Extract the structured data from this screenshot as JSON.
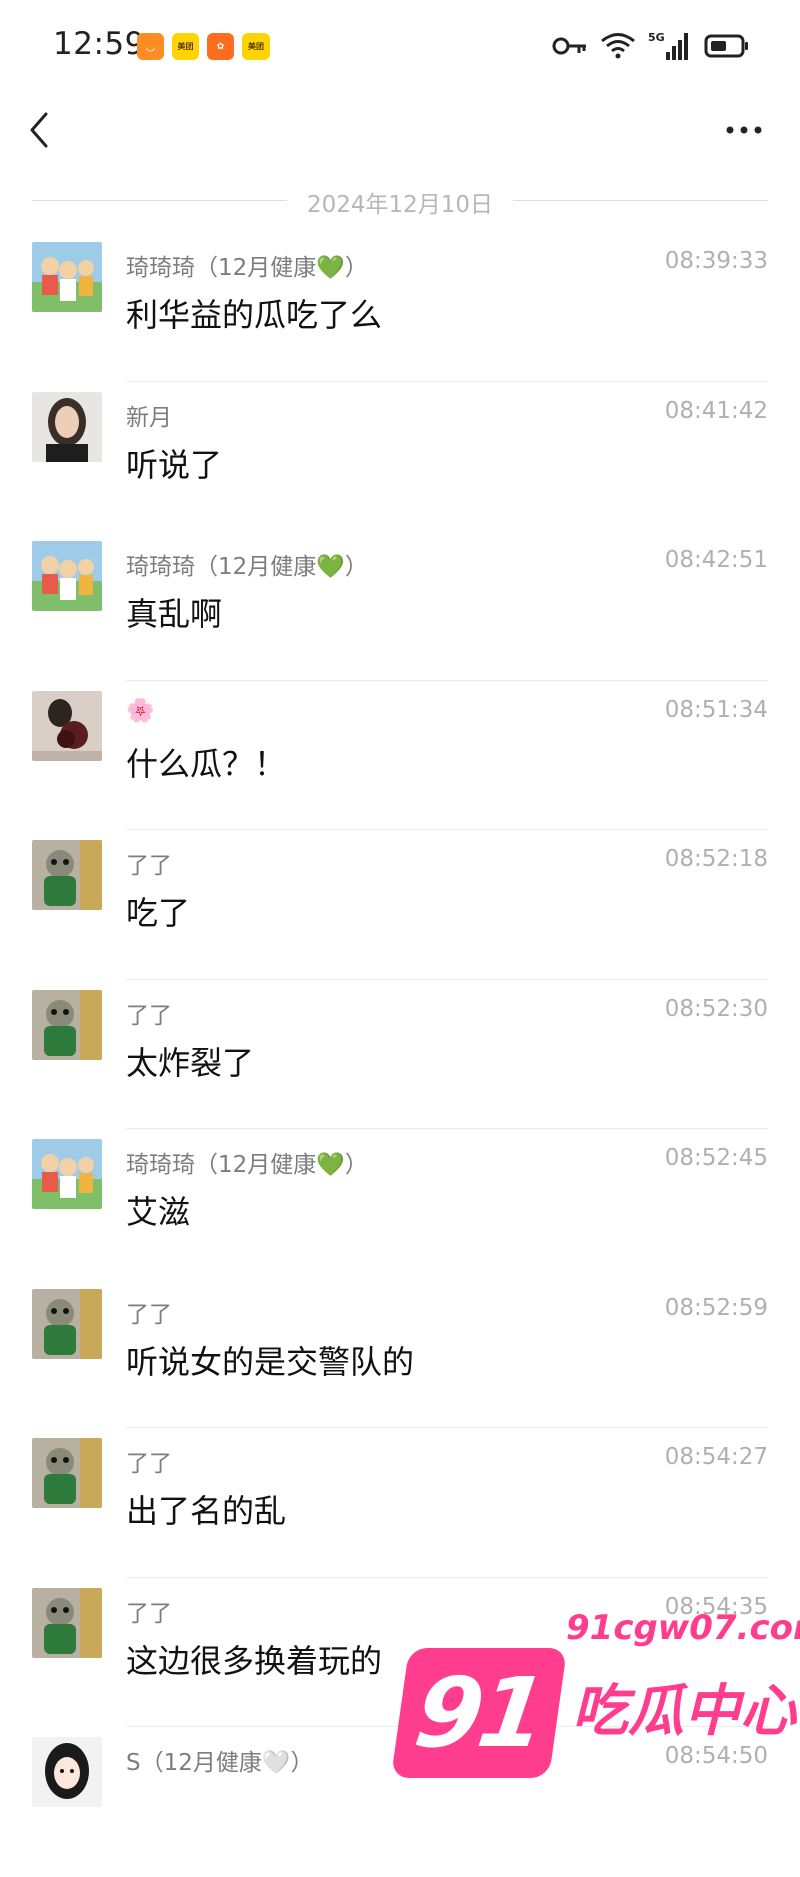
{
  "status_bar": {
    "time": "12:59",
    "badges": [
      "美团",
      "美团",
      "美团",
      "美团"
    ],
    "network": "5G"
  },
  "date_divider": "2024年12月10日",
  "messages": [
    {
      "sender": "琦琦琦（12月健康💚）",
      "time": "08:39:33",
      "text": "利华益的瓜吃了么",
      "avatar": "cartoon-group-avatar"
    },
    {
      "sender": "新月",
      "time": "08:41:42",
      "text": "听说了",
      "avatar": "woman-portrait-avatar"
    },
    {
      "sender": "琦琦琦（12月健康💚）",
      "time": "08:42:51",
      "text": "真乱啊",
      "avatar": "cartoon-group-avatar"
    },
    {
      "sender": "🌸",
      "time": "08:51:34",
      "text": "什么瓜？！",
      "avatar": "flowers-photo-avatar"
    },
    {
      "sender": "了了",
      "time": "08:52:18",
      "text": "吃了",
      "avatar": "plush-toy-avatar"
    },
    {
      "sender": "了了",
      "time": "08:52:30",
      "text": "太炸裂了",
      "avatar": "plush-toy-avatar"
    },
    {
      "sender": "琦琦琦（12月健康💚）",
      "time": "08:52:45",
      "text": "艾滋",
      "avatar": "cartoon-group-avatar"
    },
    {
      "sender": "了了",
      "time": "08:52:59",
      "text": "听说女的是交警队的",
      "avatar": "plush-toy-avatar"
    },
    {
      "sender": "了了",
      "time": "08:54:27",
      "text": "出了名的乱",
      "avatar": "plush-toy-avatar"
    },
    {
      "sender": "了了",
      "time": "08:54:35",
      "text": "这边很多换着玩的",
      "avatar": "plush-toy-avatar"
    },
    {
      "sender": "S（12月健康🤍）",
      "time": "08:54:50",
      "text": "",
      "avatar": "anime-girl-avatar"
    }
  ],
  "watermark": {
    "logo": "91",
    "url": "91cgw07.com",
    "label": "吃瓜中心"
  }
}
